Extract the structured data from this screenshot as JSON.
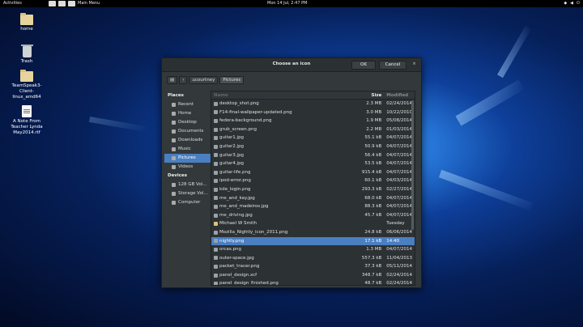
{
  "topbar": {
    "activities": "Activities",
    "app_menu": "Main Menu",
    "clock": "Mon 14 Jul,  2:47 PM"
  },
  "desktop": {
    "icons": [
      {
        "label": "home",
        "icon": "folder-icon"
      },
      {
        "label": "Trash",
        "icon": "trash-icon"
      },
      {
        "label": "TeamSpeak3-Client-linux_amd64",
        "icon": "folder-icon"
      },
      {
        "label": "A Note From Teacher Lynda May2014.rtf",
        "icon": "document-icon"
      }
    ]
  },
  "dialog": {
    "title": "Choose an icon",
    "ok": "OK",
    "cancel": "Cancel",
    "close": "×",
    "path": [
      "courtney",
      "Pictures"
    ],
    "sidebar": {
      "places_header": "Places",
      "places": [
        "Recent",
        "Home",
        "Desktop",
        "Documents",
        "Downloads",
        "Music",
        "Pictures",
        "Videos"
      ],
      "selected_place": "Pictures",
      "devices_header": "Devices",
      "devices": [
        "128 GB Vol...",
        "Storage Vol...",
        "Computer"
      ]
    },
    "columns": {
      "name": "Name",
      "size": "Size",
      "modified": "Modified"
    },
    "files": [
      {
        "name": "desktop_shot.png",
        "size": "2.3 MB",
        "modified": "02/24/2014"
      },
      {
        "name": "F14-final-wallpaper-updated.png",
        "size": "3.0 MB",
        "modified": "10/22/2010"
      },
      {
        "name": "fedora-background.png",
        "size": "1.9 MB",
        "modified": "05/08/2014"
      },
      {
        "name": "grub_screen.png",
        "size": "2.2 MB",
        "modified": "01/03/2014"
      },
      {
        "name": "guitar1.jpg",
        "size": "55.1 kB",
        "modified": "04/07/2014"
      },
      {
        "name": "guitar2.jpg",
        "size": "50.9 kB",
        "modified": "04/07/2014"
      },
      {
        "name": "guitar3.jpg",
        "size": "56.4 kB",
        "modified": "04/07/2014"
      },
      {
        "name": "guitar4.jpg",
        "size": "53.5 kB",
        "modified": "04/07/2014"
      },
      {
        "name": "guitar-life.png",
        "size": "915.4 kB",
        "modified": "04/07/2014"
      },
      {
        "name": "ipod-error.png",
        "size": "60.1 kB",
        "modified": "04/03/2014"
      },
      {
        "name": "kde_login.png",
        "size": "293.3 kB",
        "modified": "02/27/2014"
      },
      {
        "name": "me_and_kay.jpg",
        "size": "68.0 kB",
        "modified": "04/07/2014"
      },
      {
        "name": "me_and_madeiros.jpg",
        "size": "88.3 kB",
        "modified": "04/07/2014"
      },
      {
        "name": "me_driving.jpg",
        "size": "45.7 kB",
        "modified": "04/07/2014"
      },
      {
        "name": "Michael W Smith",
        "size": "",
        "modified": "Tuesday",
        "folder": true
      },
      {
        "name": "Mozilla_Nightly_icon_2011.png",
        "size": "24.8 kB",
        "modified": "06/06/2014"
      },
      {
        "name": "nightly.png",
        "size": "17.1 kB",
        "modified": "14:40",
        "selected": true
      },
      {
        "name": "orcas.png",
        "size": "1.3 MB",
        "modified": "04/07/2014"
      },
      {
        "name": "outer-space.jpg",
        "size": "557.3 kB",
        "modified": "11/04/2013"
      },
      {
        "name": "packet_tracer.png",
        "size": "37.3 kB",
        "modified": "05/11/2014"
      },
      {
        "name": "panel_design.xcf",
        "size": "348.7 kB",
        "modified": "02/24/2014"
      },
      {
        "name": "panel_design_finished.png",
        "size": "48.7 kB",
        "modified": "02/24/2014"
      }
    ]
  }
}
